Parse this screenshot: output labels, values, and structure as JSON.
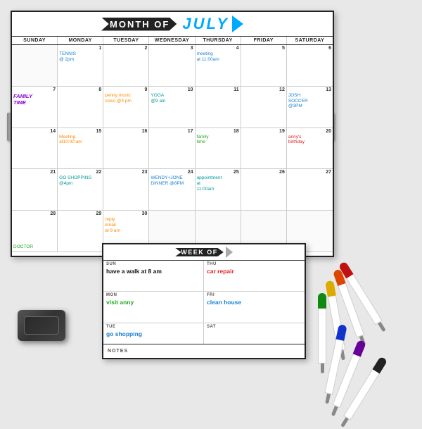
{
  "calendar": {
    "title": "MONTH OF",
    "month": "JULY",
    "days": [
      "SUNDAY",
      "MONDAY",
      "TUESDAY",
      "WEDNESDAY",
      "THURSDAY",
      "FRIDAY",
      "SATURDAY"
    ],
    "cells": [
      {
        "num": "",
        "text": "",
        "color": ""
      },
      {
        "num": "1",
        "text": "TENNIS\n@ 2pm",
        "color": "blue"
      },
      {
        "num": "2",
        "text": "",
        "color": ""
      },
      {
        "num": "3",
        "text": "",
        "color": ""
      },
      {
        "num": "4",
        "text": "meeting\nat 11:00am",
        "color": "blue"
      },
      {
        "num": "5",
        "text": "",
        "color": ""
      },
      {
        "num": "6",
        "text": "",
        "color": ""
      },
      {
        "num": "7",
        "text": "FAMILY\nTIME",
        "color": "purple"
      },
      {
        "num": "8",
        "text": "",
        "color": ""
      },
      {
        "num": "9",
        "text": "penny music\nclass @4 pm",
        "color": "orange"
      },
      {
        "num": "10",
        "text": "YOGA\n@9 am",
        "color": "teal"
      },
      {
        "num": "11",
        "text": "",
        "color": ""
      },
      {
        "num": "12",
        "text": "",
        "color": ""
      },
      {
        "num": "13",
        "text": "JOSH\nSOCCER\n@3PM",
        "color": "blue"
      },
      {
        "num": "14",
        "text": "",
        "color": ""
      },
      {
        "num": "15",
        "text": "Meeting\nat10:00 am",
        "color": "orange"
      },
      {
        "num": "16",
        "text": "",
        "color": ""
      },
      {
        "num": "17",
        "text": "",
        "color": ""
      },
      {
        "num": "18",
        "text": "family\ntime",
        "color": "green"
      },
      {
        "num": "19",
        "text": "",
        "color": ""
      },
      {
        "num": "20",
        "text": "anny's\nbirthday",
        "color": "red"
      },
      {
        "num": "21",
        "text": "",
        "color": ""
      },
      {
        "num": "22",
        "text": "GO SHOPPING\n@4pm",
        "color": "teal"
      },
      {
        "num": "23",
        "text": "",
        "color": ""
      },
      {
        "num": "24",
        "text": "WENDY+JONE\nDINNER @8PM",
        "color": "blue"
      },
      {
        "num": "25",
        "text": "appointment\nat\n11:00am",
        "color": "teal"
      },
      {
        "num": "26",
        "text": "",
        "color": ""
      },
      {
        "num": "27",
        "text": "",
        "color": ""
      },
      {
        "num": "28",
        "text": "DOCTOR",
        "color": "green"
      },
      {
        "num": "29",
        "text": "",
        "color": ""
      },
      {
        "num": "30",
        "text": "reply\nemail\nat 9 am",
        "color": "orange"
      },
      {
        "num": "",
        "text": "",
        "color": ""
      },
      {
        "num": "",
        "text": "",
        "color": ""
      },
      {
        "num": "",
        "text": "",
        "color": ""
      },
      {
        "num": "",
        "text": "",
        "color": ""
      }
    ]
  },
  "week_calendar": {
    "title": "WEEK OF",
    "cells": [
      {
        "day": "SUN",
        "text": "have a walk at 8 am",
        "color": "black"
      },
      {
        "day": "THU",
        "text": "car repair",
        "color": "red"
      },
      {
        "day": "MON",
        "text": "visit anny",
        "color": "green"
      },
      {
        "day": "FRI",
        "text": "clean house",
        "color": "blue"
      },
      {
        "day": "TUE",
        "text": "go shopping",
        "color": "blue"
      },
      {
        "day": "SAT",
        "text": "",
        "color": ""
      }
    ],
    "notes_label": "NOTES"
  },
  "markers": [
    {
      "color": "#e02020",
      "cap_color": "#c01010"
    },
    {
      "color": "#ff6600",
      "cap_color": "#dd4400"
    },
    {
      "color": "#ffcc00",
      "cap_color": "#ddaa00"
    },
    {
      "color": "#22bb22",
      "cap_color": "#118811"
    },
    {
      "color": "#2244ff",
      "cap_color": "#1133cc"
    },
    {
      "color": "#8800cc",
      "cap_color": "#660099"
    },
    {
      "color": "#111111",
      "cap_color": "#000000"
    }
  ]
}
